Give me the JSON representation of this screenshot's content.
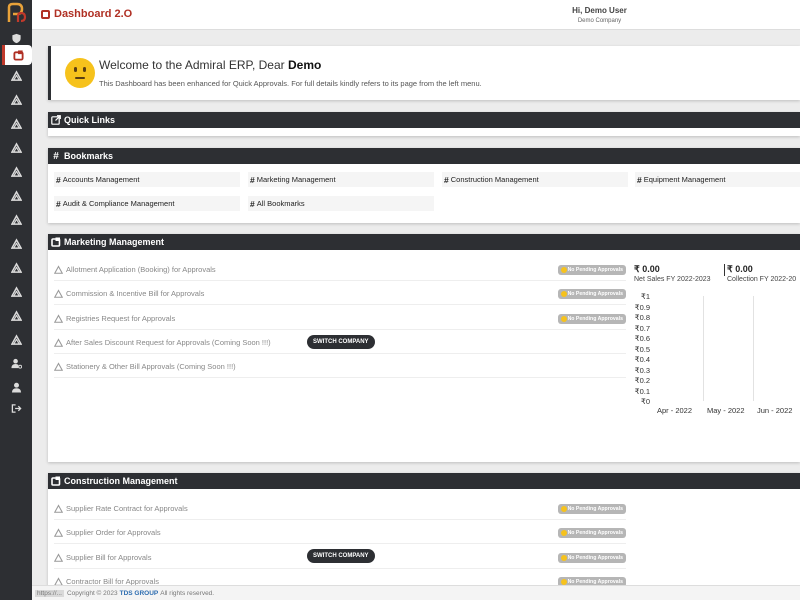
{
  "app": {
    "title": "Dashboard 2.O",
    "user_greeting": "Hi, Demo User",
    "company": "Demo Company"
  },
  "welcome": {
    "title_prefix": "Welcome to the Admiral ERP, Dear ",
    "user": "Demo",
    "message": "This Dashboard has been enhanced for Quick Approvals. For full details kindly refers to its page from the left menu."
  },
  "quick_links": {
    "title": "Quick Links"
  },
  "bookmarks": {
    "title": "Bookmarks",
    "hash_symbol": "#",
    "items": [
      "Accounts Management",
      "Marketing Management",
      "Construction Management",
      "Equipment Management",
      "Audit & Compliance Management",
      "All Bookmarks"
    ]
  },
  "marketing": {
    "title": "Marketing Management",
    "approvals": [
      {
        "label": "Allotment Application (Booking) for Approvals",
        "badge": "No Pending Approvals"
      },
      {
        "label": "Commission & Incentive Bill for Approvals",
        "badge": "No Pending Approvals"
      },
      {
        "label": "Registries Request for Approvals",
        "badge": "No Pending Approvals"
      },
      {
        "label": "After Sales Discount Request for Approvals (Coming Soon !!!)",
        "badge": ""
      },
      {
        "label": "Stationery & Other Bill Approvals (Coming Soon !!!)",
        "badge": ""
      }
    ],
    "switch_label": "SWITCH COMPANY",
    "kpis": [
      {
        "value": "₹ 0.00",
        "label": "Net Sales FY 2022-2023"
      },
      {
        "value": "₹ 0.00",
        "label": "Collection FY 2022-20"
      }
    ]
  },
  "chart_data": {
    "type": "bar",
    "categories": [
      "Apr - 2022",
      "May - 2022",
      "Jun - 2022"
    ],
    "values": [
      0,
      0,
      0
    ],
    "yticks": [
      "₹1",
      "₹0.9",
      "₹0.8",
      "₹0.7",
      "₹0.6",
      "₹0.5",
      "₹0.4",
      "₹0.3",
      "₹0.2",
      "₹0.1",
      "₹0"
    ],
    "ylim": [
      0,
      1
    ],
    "grid": true
  },
  "construction": {
    "title": "Construction Management",
    "approvals": [
      {
        "label": "Supplier Rate Contract for Approvals",
        "badge": "No Pending Approvals"
      },
      {
        "label": "Supplier Order for Approvals",
        "badge": "No Pending Approvals"
      },
      {
        "label": "Supplier Bill for Approvals",
        "badge": "No Pending Approvals"
      },
      {
        "label": "Contractor Bill for Approvals",
        "badge": "No Pending Approvals"
      }
    ],
    "switch_label": "SWITCH COMPANY"
  },
  "footer": {
    "status_url": "https://...",
    "copyright": "Copyright © 2023",
    "brand": "TDS GROUP",
    "rights": "All rights reserved."
  },
  "colors": {
    "sidebar": "#2d2f33",
    "accent": "#b03024",
    "badge": "#b6b6b6",
    "smiley": "#f6c21c"
  }
}
